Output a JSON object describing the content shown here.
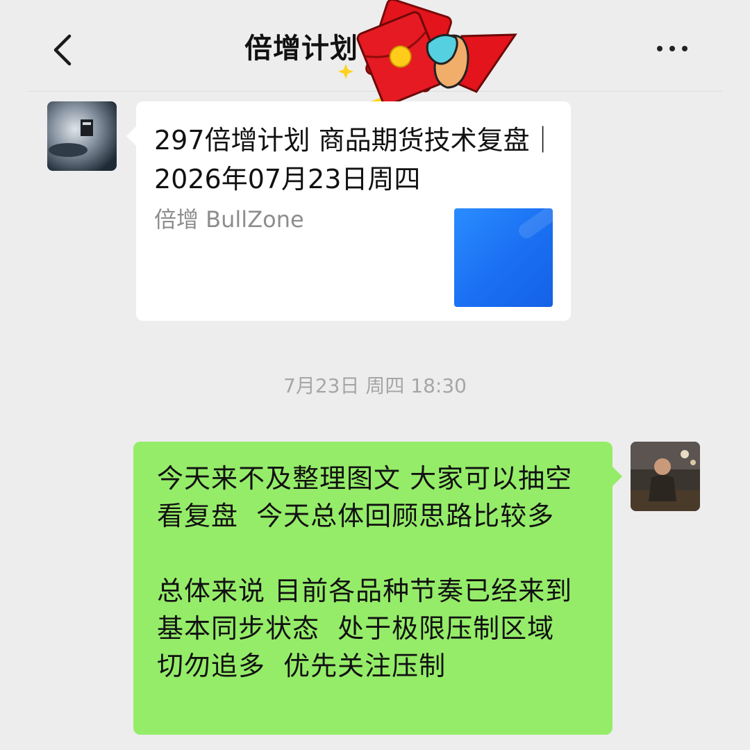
{
  "header": {
    "title": "倍增计划",
    "back_icon": "chevron-left-icon",
    "more_icon": "more-dots-icon"
  },
  "messages": {
    "shared_card": {
      "title": "297倍增计划 商品期货技术复盘｜2026年07月23日周四",
      "source": "倍增 BullZone",
      "thumbnail_color": "#1a6ff2"
    },
    "timestamp": "7月23日 周四 18:30",
    "outgoing_text": "今天来不及整理图文 大家可以抽空看复盘  今天总体回顾思路比较多\n\n总体来说 目前各品种节奏已经来到基本同步状态  处于极限压制区域  切勿追多  优先关注压制"
  },
  "colors": {
    "background": "#ededed",
    "bubble_green": "#95ec69",
    "card_white": "#ffffff",
    "timestamp_gray": "#a6a6a6"
  },
  "sticker": "red-envelope-sticker"
}
